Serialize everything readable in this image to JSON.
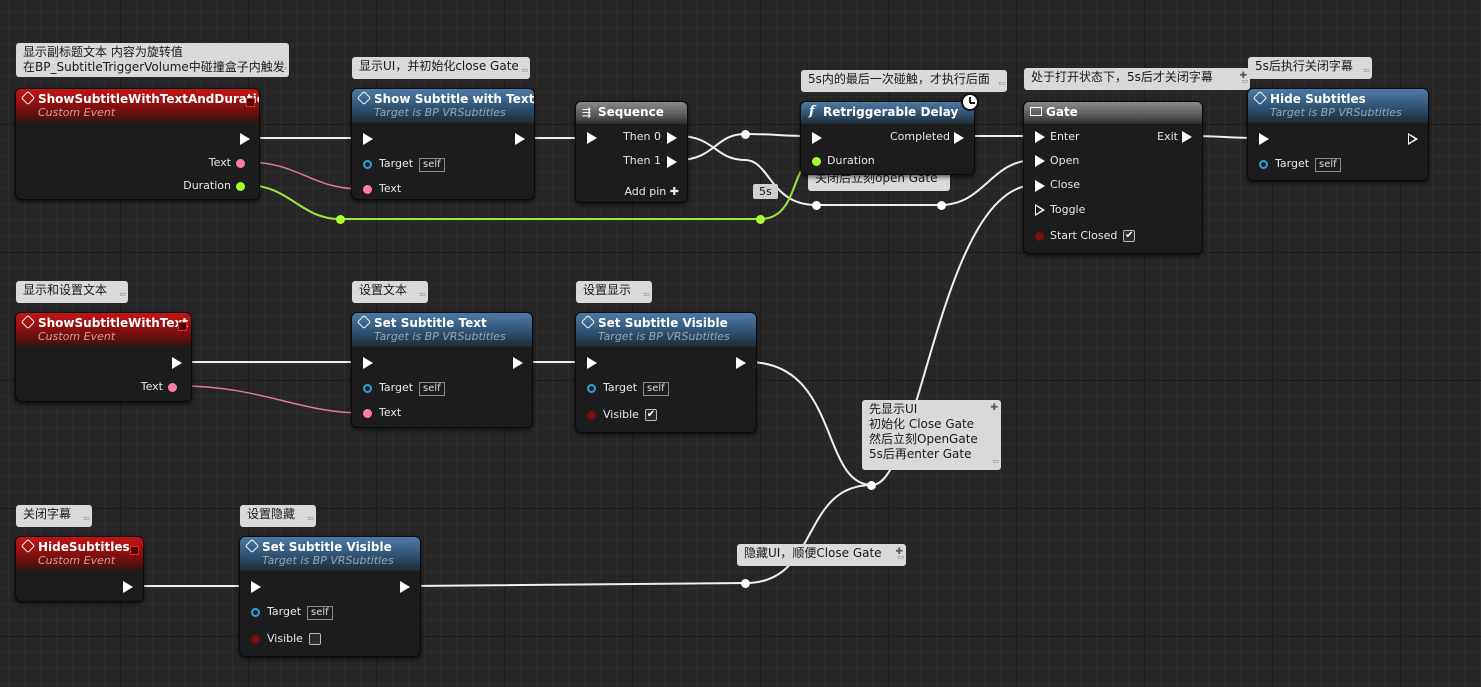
{
  "comments": {
    "c1": [
      "显示副标题文本 内容为旋转值",
      "在BP_SubtitleTriggerVolume中碰撞盒子内触发"
    ],
    "c2": "显示UI，并初始化close Gate",
    "c3": "5s内的最后一次碰触，才执行后面",
    "c4": "处于打开状态下，5s后才关闭字幕",
    "c5": "5s后执行关闭字幕",
    "c6": "关闭后立刻open Gate",
    "c7": "显示和设置文本",
    "c8": "设置文本",
    "c9": "设置显示",
    "c10": [
      "先显示UI",
      "初始化 Close Gate",
      "然后立刻OpenGate",
      "5s后再enter Gate"
    ],
    "c11": "关闭字幕",
    "c12": "设置隐藏",
    "c13": "隐藏UI，顺便Close Gate"
  },
  "nodes": {
    "ev1": {
      "title": "ShowSubtitleWithTextAndDuration",
      "sub": "Custom Event",
      "text": "Text",
      "duration": "Duration"
    },
    "show": {
      "title": "Show Subtitle with Text",
      "sub": "Target is BP VRSubtitles",
      "target": "Target",
      "self": "self",
      "text": "Text"
    },
    "seq": {
      "title": "Sequence",
      "then0": "Then 0",
      "then1": "Then 1",
      "add": "Add pin ✚"
    },
    "delay": {
      "title": "Retriggerable Delay",
      "completed": "Completed",
      "duration": "Duration",
      "value": "5s"
    },
    "gate": {
      "title": "Gate",
      "enter": "Enter",
      "open": "Open",
      "close": "Close",
      "toggle": "Toggle",
      "start": "Start Closed",
      "exit": "Exit"
    },
    "hide": {
      "title": "Hide Subtitles",
      "sub": "Target is BP VRSubtitles",
      "target": "Target",
      "self": "self"
    },
    "ev2": {
      "title": "ShowSubtitleWithText",
      "sub": "Custom Event",
      "text": "Text"
    },
    "settext": {
      "title": "Set Subtitle Text",
      "sub": "Target is BP VRSubtitles",
      "target": "Target",
      "self": "self",
      "text": "Text"
    },
    "setvis": {
      "title": "Set Subtitle Visible",
      "sub": "Target is BP VRSubtitles",
      "target": "Target",
      "self": "self",
      "visible": "Visible"
    },
    "ev3": {
      "title": "HideSubtitles",
      "sub": "Custom Event"
    },
    "setvis2": {
      "title": "Set Subtitle Visible",
      "sub": "Target is BP VRSubtitles",
      "target": "Target",
      "self": "self",
      "visible": "Visible"
    }
  },
  "icons": {
    "event": "event-diamond-icon",
    "function": "function-f-icon",
    "sequence": "sequence-icon",
    "gate": "gate-icon",
    "delay": "clock-icon"
  },
  "colors": {
    "exec": "#ffffff",
    "string": "#ff7ab0",
    "float": "#a6ff33",
    "object": "#2aa3e6",
    "event_header": "#c31414",
    "function_header": "#4c7aa6"
  }
}
